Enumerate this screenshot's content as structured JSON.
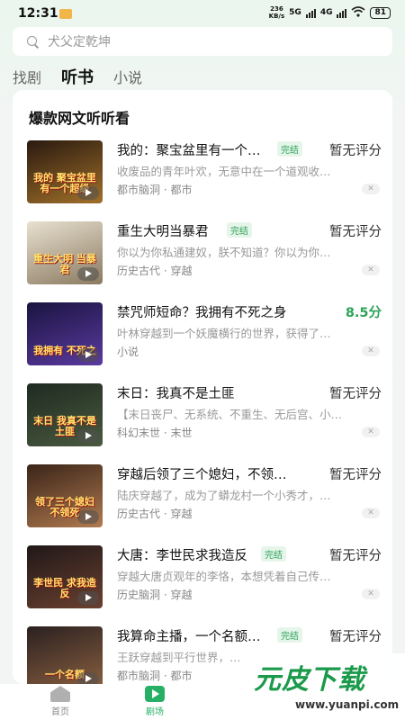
{
  "status": {
    "time": "12:31",
    "speed_top": "236",
    "speed_bottom": "KB/s",
    "net": "5G",
    "net2": "4G",
    "battery": "81"
  },
  "search": {
    "placeholder": "犬父定乾坤"
  },
  "tabs": [
    {
      "label": "找剧",
      "active": false
    },
    {
      "label": "听书",
      "active": true
    },
    {
      "label": "小说",
      "active": false
    }
  ],
  "section_title": "爆款网文听听看",
  "books": [
    {
      "title": "我的：聚宝盆里有一个…",
      "badge": "完结",
      "rating": "暂无评分",
      "desc": "收废品的青年叶欢，无意中在一个道观收…",
      "tag": "都市脑洞 · 都市",
      "cover_text": "我的 聚宝盆里 有一个超级",
      "cover_colors": [
        "#2a1a10",
        "#a0702a"
      ]
    },
    {
      "title": "重生大明当暴君",
      "badge": "完结",
      "rating": "暂无评分",
      "desc": "你以为你私通建奴，朕不知道？你以为你…",
      "tag": "历史古代 · 穿越",
      "cover_text": "重生大明 当暴君",
      "cover_colors": [
        "#e8e0d0",
        "#8a7a60"
      ]
    },
    {
      "title": "禁咒师短命？我拥有不死之身",
      "badge": "",
      "rating": "8.5分",
      "desc": "叶林穿越到一个妖魔横行的世界，获得了…",
      "tag": "小说",
      "cover_text": "我拥有 不死之",
      "cover_colors": [
        "#1a1440",
        "#5a3aa0"
      ]
    },
    {
      "title": "末日：我真不是土匪",
      "badge": "",
      "rating": "暂无评分",
      "desc": "【末日丧尸、无系统、不重生、无后宫、小…",
      "tag": "科幻末世 · 末世",
      "cover_text": "末日 我真不是土匪",
      "cover_colors": [
        "#1e2a20",
        "#4a5a40"
      ]
    },
    {
      "title": "穿越后领了三个媳妇，不领…",
      "badge": "",
      "rating": "暂无评分",
      "desc": "陆庆穿越了，成为了蟒龙村一个小秀才，…",
      "tag": "历史古代 · 穿越",
      "cover_text": "领了三个媳妇 不领死",
      "cover_colors": [
        "#3a2418",
        "#b07a50"
      ]
    },
    {
      "title": "大唐：李世民求我造反",
      "badge": "完结",
      "rating": "暂无评分",
      "desc": "穿越大唐贞观年的李恪，本想凭着自己传…",
      "tag": "历史脑洞 · 穿越",
      "cover_text": "李世民 求我造反",
      "cover_colors": [
        "#201818",
        "#6a4030"
      ]
    },
    {
      "title": "我算命主播，一个名额…",
      "badge": "完结",
      "rating": "暂无评分",
      "desc": "王跃穿越到平行世界，…",
      "tag": "都市脑洞 · 都市",
      "cover_text": "一个名额",
      "cover_colors": [
        "#2a2020",
        "#8a6040"
      ]
    }
  ],
  "nav": [
    {
      "label": "首页",
      "icon": "home-icon",
      "active": false
    },
    {
      "label": "剧场",
      "icon": "play-icon",
      "active": true
    }
  ],
  "watermark": {
    "main": "元皮下载",
    "url": "www.yuanpi.com"
  },
  "colors": {
    "accent": "#26b066",
    "badge_bg": "#e6f5ea",
    "muted": "#999999"
  }
}
